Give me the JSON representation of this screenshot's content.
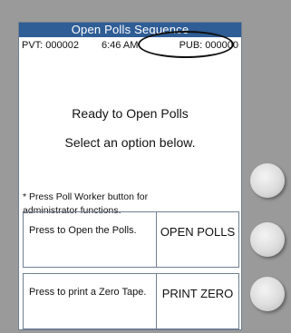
{
  "title": "Open Polls Sequence",
  "status": {
    "pvt": "PVT: 000002",
    "time": "6:46 AM",
    "pub": "PUB: 000000"
  },
  "main": {
    "message": "Ready to Open Polls",
    "instruction": "Select an option below."
  },
  "note": "* Press Poll Worker button for administrator functions.",
  "options": [
    {
      "description": "Press to Open the Polls.",
      "action": "OPEN POLLS"
    },
    {
      "description": "Press to print a Zero Tape.",
      "action": "PRINT ZERO"
    }
  ],
  "colors": {
    "title_bar": "#2f5d95",
    "bezel": "#9a9a9a",
    "screen": "#ffffff"
  }
}
